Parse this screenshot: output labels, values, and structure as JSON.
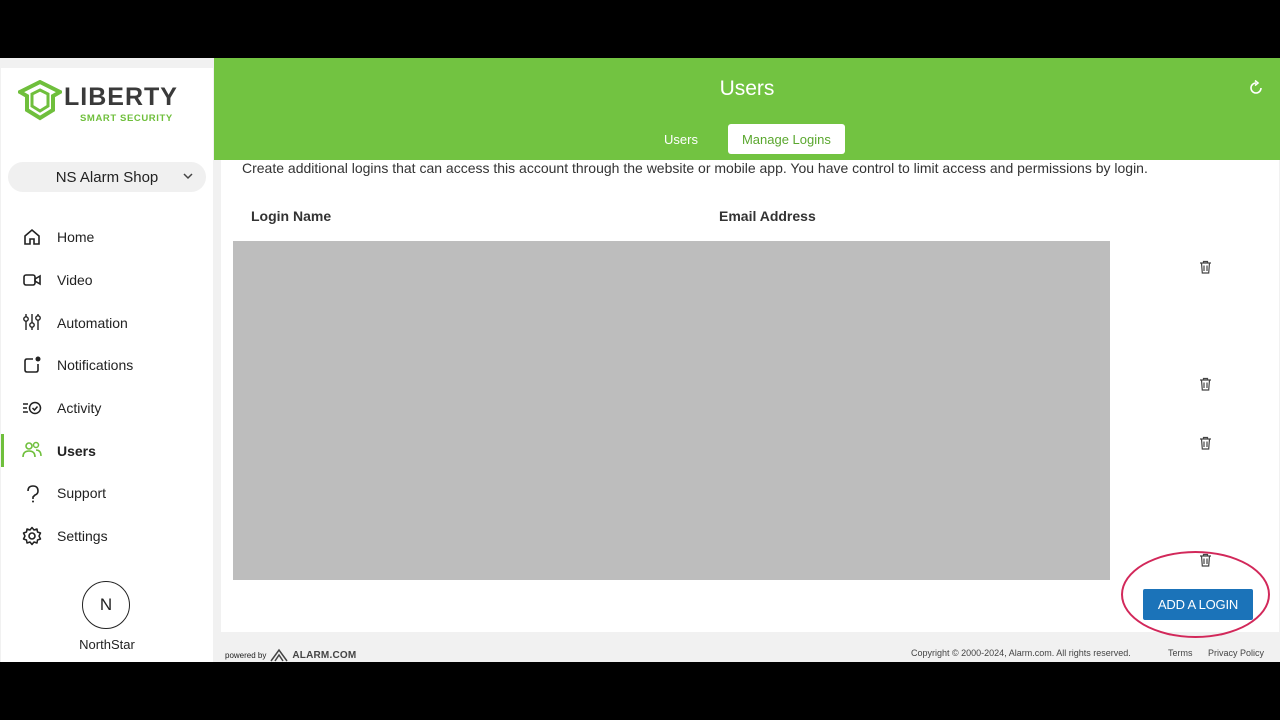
{
  "brand": {
    "name": "LIBERTY",
    "tagline": "SMART SECURITY"
  },
  "account_selector": {
    "value": "NS Alarm Shop"
  },
  "nav": [
    {
      "label": "Home",
      "icon": "home-icon"
    },
    {
      "label": "Video",
      "icon": "video-icon"
    },
    {
      "label": "Automation",
      "icon": "automation-icon"
    },
    {
      "label": "Notifications",
      "icon": "notifications-icon"
    },
    {
      "label": "Activity",
      "icon": "activity-icon"
    },
    {
      "label": "Users",
      "icon": "users-icon",
      "active": true
    },
    {
      "label": "Support",
      "icon": "support-icon"
    },
    {
      "label": "Settings",
      "icon": "settings-icon"
    }
  ],
  "user": {
    "initial": "N",
    "name": "NorthStar"
  },
  "header": {
    "title": "Users",
    "tabs": [
      {
        "label": "Users"
      },
      {
        "label": "Manage Logins",
        "selected": true
      }
    ]
  },
  "main": {
    "description": "Create additional logins that can access this account through the website or mobile app. You have control to limit access and permissions by login.",
    "columns": {
      "login_name": "Login Name",
      "email_address": "Email Address"
    },
    "add_button": "ADD A LOGIN",
    "delete_icon": "trash-icon"
  },
  "footer": {
    "powered_by": "powered by",
    "provider": "ALARM.COM",
    "copyright": "Copyright © 2000-2024, Alarm.com. All rights reserved.",
    "terms": "Terms",
    "privacy": "Privacy Policy"
  },
  "colors": {
    "header_green": "#72c341",
    "button_blue": "#1b73b9",
    "highlight_circle": "#d2285a"
  }
}
